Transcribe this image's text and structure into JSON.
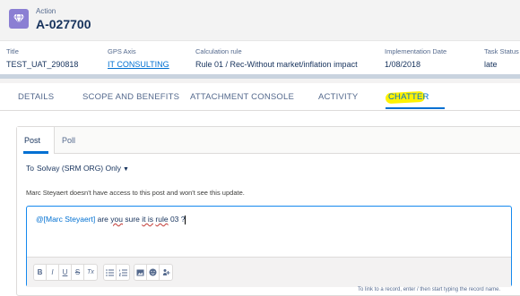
{
  "record": {
    "type": "Action",
    "name": "A-027700",
    "icon": "diamond-icon",
    "icon_color": "#8b7fd3"
  },
  "highlights": [
    {
      "label": "Title",
      "value": "TEST_UAT_290818"
    },
    {
      "label": "GPS Axis",
      "value": "IT CONSULTING"
    },
    {
      "label": "Calculation rule",
      "value": "Rule 01 / Rec-Without market/inflation impact"
    },
    {
      "label": "Implementation Date",
      "value": "1/08/2018"
    },
    {
      "label": "Task Status",
      "value": "late"
    }
  ],
  "tabs": [
    "DETAILS",
    "SCOPE AND BENEFITS",
    "ATTACHMENT CONSOLE",
    "ACTIVITY",
    "CHATTER"
  ],
  "active_tab": "CHATTER",
  "publisher": {
    "tabs": [
      "Post",
      "Poll"
    ],
    "active_tab": "Post",
    "to_label": "To",
    "audience": "Solvay (SRM ORG) Only",
    "warning": "Marc Steyaert doesn't have access to this post and won't see this update.",
    "body": {
      "mention": "@[Marc Steyaert]",
      "text_before": " are ",
      "word_you": "you",
      "text_mid": " sure ",
      "word_itis": "it is",
      "text_mid2": " ",
      "word_rule": "rule",
      "text_after": " 03 ?"
    },
    "toolbar": [
      [
        "B",
        "I",
        "U",
        "S",
        "Tx"
      ],
      [
        "bulleted-list-icon",
        "numbered-list-icon"
      ],
      [
        "image-icon",
        "emoji-icon",
        "attachment-icon"
      ]
    ],
    "hint": "To link to a record, enter / then start typing the record name."
  },
  "colors": {
    "link": "#0070d2",
    "highlight": "#fff200",
    "focus_border": "#1589ee"
  }
}
